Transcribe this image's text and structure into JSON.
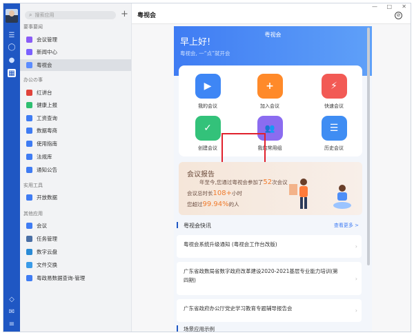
{
  "sidebar": {
    "search_placeholder": "搜索应用",
    "sections": {
      "important": "要事要闻",
      "office": "办公の事",
      "tools": "实用工具",
      "other": "其他应用"
    },
    "items": [
      {
        "label": "会议管理",
        "color": "#8a5cf6"
      },
      {
        "label": "新闻中心",
        "color": "#7b61ff"
      },
      {
        "label": "粤视会",
        "color": "#5b8cff"
      },
      {
        "label": "红讲台",
        "color": "#e0433b"
      },
      {
        "label": "健康上报",
        "color": "#2fbf71"
      },
      {
        "label": "工资查询",
        "color": "#3f7cf3"
      },
      {
        "label": "数据粤商",
        "color": "#3f7cf3"
      },
      {
        "label": "使用指南",
        "color": "#3f7cf3"
      },
      {
        "label": "法规库",
        "color": "#3f7cf3"
      },
      {
        "label": "通知公告",
        "color": "#3f7cf3"
      },
      {
        "label": "开放数据",
        "color": "#3f7cf3"
      },
      {
        "label": "会议",
        "color": "#3f7cf3"
      },
      {
        "label": "任务管理",
        "color": "#4a6fa5"
      },
      {
        "label": "数字云盘",
        "color": "#2a8bd6"
      },
      {
        "label": "文件交换",
        "color": "#3a9be8"
      },
      {
        "label": "粤政易数据查询-管理",
        "color": "#3f7cf3"
      }
    ]
  },
  "main": {
    "title": "粤视会",
    "phone": {
      "banner_title": "粤视会",
      "greeting": "早上好!",
      "slogan": "粤视会, 一“点”就开会",
      "tiles": [
        {
          "label": "我的会议",
          "color": "#3e86f5",
          "glyph": "▶"
        },
        {
          "label": "加入会议",
          "color": "#ff8a2a",
          "glyph": "+"
        },
        {
          "label": "快速会议",
          "color": "#f25a55",
          "glyph": "⚡"
        },
        {
          "label": "创建会议",
          "color": "#33c27a",
          "glyph": "✓"
        },
        {
          "label": "我的常用组",
          "color": "#8b6cf0",
          "glyph": "👥"
        },
        {
          "label": "历史会议",
          "color": "#3f8df3",
          "glyph": "☰"
        }
      ],
      "report": {
        "title": "会议报告",
        "line1_prefix": "年至今,您通过粤视会参加了",
        "line1_num": "52",
        "line1_suffix": "次会议",
        "line2_prefix": "会议总时长",
        "line2_num": "108+",
        "line2_suffix": "小时",
        "line3_prefix": "您超过",
        "line3_num": "99.94%",
        "line3_suffix": "的人"
      },
      "news_title": "粤视会快讯",
      "news_more": "查看更多 >",
      "news": [
        "粤视会系统升级通知 (粤视会工作台改版)",
        "广东省政数局省数字政府改革建设2020-2021基层专业能力培训(第四期)",
        "广东省政府办公厅党史学习教育专题辅导报告会"
      ],
      "bottom_title": "场景应用示例"
    }
  }
}
